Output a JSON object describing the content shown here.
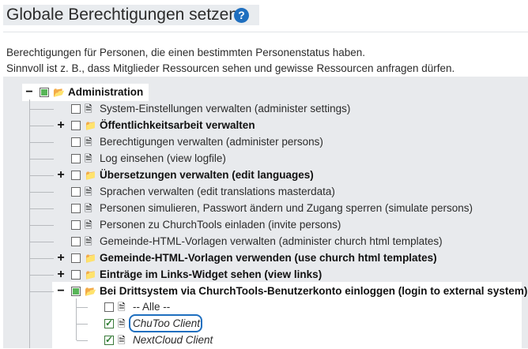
{
  "header": {
    "title": "Globale Berechtigungen setzen",
    "help_icon": "question-circle-icon",
    "help_glyph": "?"
  },
  "description": {
    "line1": "Berechtigungen für Personen, die einen bestimmten Personenstatus haben.",
    "line2": "Sinnvoll ist z. B., dass Mitglieder Ressourcen sehen und gewisse Ressourcen anfragen dürfen."
  },
  "colors": {
    "accent": "#1f6fbf",
    "partial_check": "#58b558",
    "panel_background": "#e8eaed"
  },
  "tree": {
    "root": {
      "toggle": "−",
      "state": "partial",
      "icon": "folder-open-icon",
      "label": "Administration"
    },
    "children": [
      {
        "toggle": "",
        "state": "unchecked",
        "icon": "file-icon",
        "label": "System-Einstellungen verwalten (administer settings)",
        "bold": false
      },
      {
        "toggle": "+",
        "state": "unchecked",
        "icon": "folder-icon",
        "label": "Öffentlichkeitsarbeit verwalten",
        "bold": true
      },
      {
        "toggle": "",
        "state": "unchecked",
        "icon": "file-icon",
        "label": "Berechtigungen verwalten (administer persons)",
        "bold": false
      },
      {
        "toggle": "",
        "state": "unchecked",
        "icon": "file-icon",
        "label": "Log einsehen (view logfile)",
        "bold": false
      },
      {
        "toggle": "+",
        "state": "unchecked",
        "icon": "folder-icon",
        "label": "Übersetzungen verwalten (edit languages)",
        "bold": true
      },
      {
        "toggle": "",
        "state": "unchecked",
        "icon": "file-icon",
        "label": "Sprachen verwalten (edit translations masterdata)",
        "bold": false
      },
      {
        "toggle": "",
        "state": "unchecked",
        "icon": "file-icon",
        "label": "Personen simulieren, Passwort ändern und Zugang sperren (simulate persons)",
        "bold": false
      },
      {
        "toggle": "",
        "state": "unchecked",
        "icon": "file-icon",
        "label": "Personen zu ChurchTools einladen (invite persons)",
        "bold": false
      },
      {
        "toggle": "",
        "state": "unchecked",
        "icon": "file-icon",
        "label": "Gemeinde-HTML-Vorlagen verwalten (administer church html templates)",
        "bold": false
      },
      {
        "toggle": "+",
        "state": "unchecked",
        "icon": "folder-icon",
        "label": "Gemeinde-HTML-Vorlagen verwenden (use church html templates)",
        "bold": true
      },
      {
        "toggle": "+",
        "state": "unchecked",
        "icon": "folder-icon",
        "label": "Einträge im Links-Widget sehen (view links)",
        "bold": true
      },
      {
        "toggle": "−",
        "state": "partial",
        "icon": "folder-open-icon",
        "label": "Bei Drittsystem via ChurchTools-Benutzerkonto einloggen (login to external system)",
        "bold": true
      }
    ],
    "grandchildren": [
      {
        "state": "unchecked",
        "icon": "file-icon",
        "label": "-- Alle --",
        "italic": false
      },
      {
        "state": "checked",
        "icon": "file-icon",
        "label": "ChuToo Client",
        "italic": true
      },
      {
        "state": "checked",
        "icon": "file-icon",
        "label": "NextCloud Client",
        "italic": true
      }
    ]
  }
}
